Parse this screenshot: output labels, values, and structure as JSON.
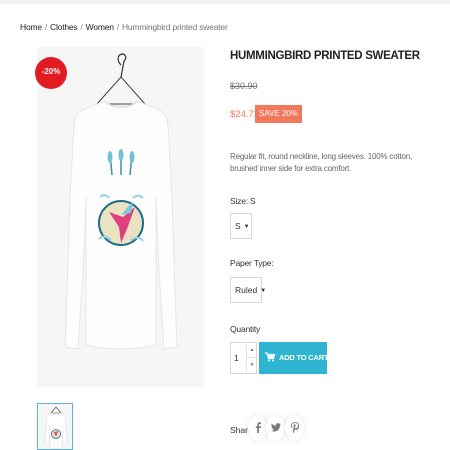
{
  "breadcrumb": {
    "items": [
      "Home",
      "Clothes",
      "Women"
    ],
    "current": "Hummingbird printed sweater",
    "separator": "/"
  },
  "product": {
    "title": "HUMMINGBIRD PRINTED SWEATER",
    "discount_badge": "-20%",
    "old_price": "$30.90",
    "new_price": "$24.72",
    "save_badge": "SAVE 20%",
    "description": "Regular fit, round neckline, long sleeves. 100% cotton, brushed inner side for extra comfort."
  },
  "options": {
    "size_label": "Size: S",
    "size_value": "S",
    "paper_label": "Paper Type:",
    "paper_value": "Ruled"
  },
  "quantity": {
    "label": "Quantity",
    "value": "1",
    "add_to_cart": "ADD TO CART"
  },
  "share": {
    "label": "Share",
    "icons": [
      "facebook-icon",
      "twitter-icon",
      "pinterest-icon"
    ]
  },
  "colors": {
    "accent": "#2fb5d2",
    "sale": "#f1785b",
    "badge": "#e21b23"
  }
}
